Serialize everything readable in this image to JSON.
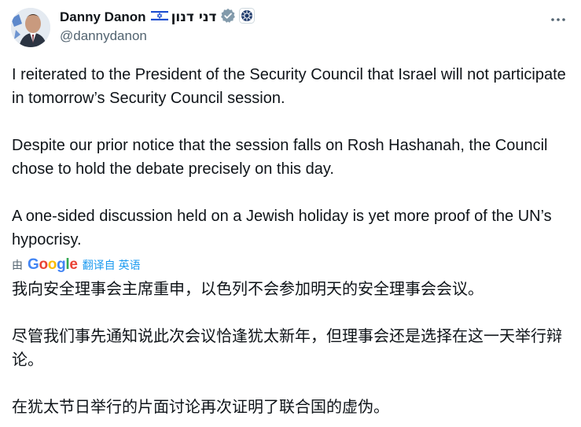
{
  "author": {
    "display_name": "Danny Danon",
    "hebrew_name": "דני דנון",
    "handle": "@dannydanon"
  },
  "tweet": {
    "paragraphs": [
      "I reiterated to the President of the Security Council that Israel will not participate in tomorrow’s Security Council session.",
      "Despite our prior notice that the session falls on Rosh Hashanah, the Council chose to hold the debate precisely on this day.",
      "A one-sided discussion held on a Jewish holiday is yet more proof of the UN’s hypocrisy."
    ]
  },
  "translation": {
    "by_label": "由",
    "provider": "Google",
    "link_label": "翻译自 英语",
    "paragraphs": [
      "我向安全理事会主席重申，以色列不会参加明天的安全理事会会议。",
      "尽管我们事先通知说此次会议恰逢犹太新年，但理事会还是选择在这一天举行辩论。",
      "在犹太节日举行的片面讨论再次证明了联合国的虚伪。"
    ]
  },
  "colors": {
    "text": "#0f1419",
    "secondary": "#536471",
    "link": "#1d9bf0",
    "verified_badge": "#829aab"
  },
  "icons": [
    "avatar",
    "israel-flag-icon",
    "verified-badge-icon",
    "affiliate-badge-icon",
    "more-icon",
    "google-logo"
  ]
}
